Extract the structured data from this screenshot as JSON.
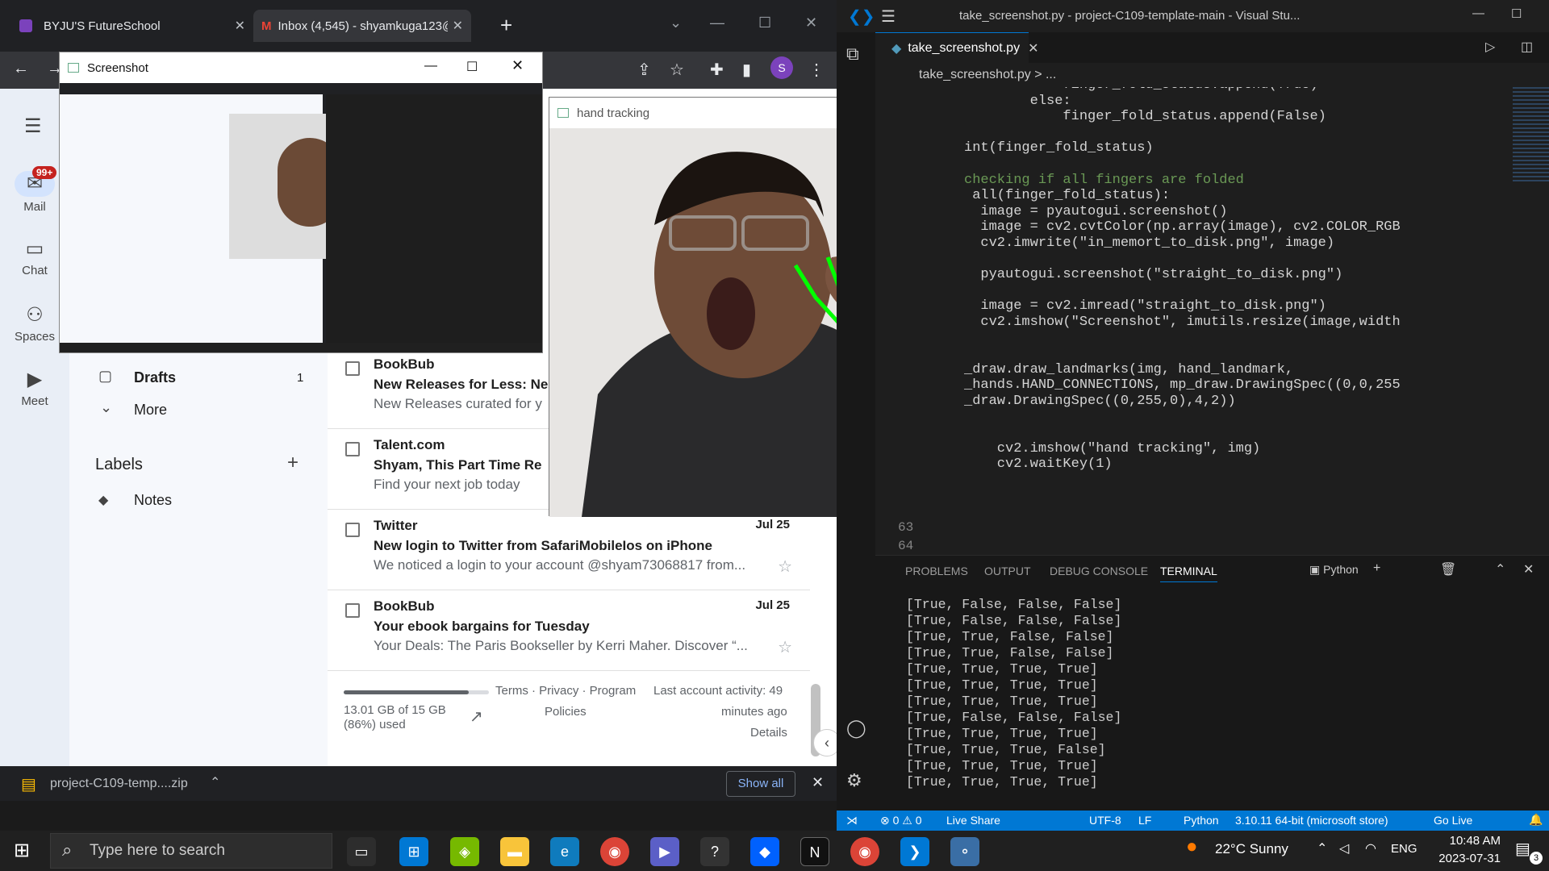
{
  "chrome": {
    "tab1_title": "BYJU'S FutureSchool",
    "tab2_title": "Inbox (4,545) - shyamkuga123@",
    "avatar_letter": "S"
  },
  "gmail": {
    "rail": {
      "mail": "Mail",
      "chat": "Chat",
      "spaces": "Spaces",
      "meet": "Meet",
      "badge": "99+"
    },
    "nav": {
      "drafts": "Drafts",
      "drafts_count": "1",
      "more": "More",
      "labels": "Labels",
      "notes": "Notes"
    },
    "emails": [
      {
        "sender": "BookBub",
        "subject": "New Releases for Less: Ne",
        "snippet": "New Releases curated for y",
        "date": ""
      },
      {
        "sender": "Talent.com",
        "subject": "Shyam, This Part Time Re",
        "snippet": "Find your next job today",
        "date": ""
      },
      {
        "sender": "Twitter",
        "subject": "New login to Twitter from SafariMobileIos on iPhone",
        "snippet": "We noticed a login to your account @shyam73068817 from...",
        "date": "Jul 25"
      },
      {
        "sender": "BookBub",
        "subject": "Your ebook bargains for Tuesday",
        "snippet": "Your Deals: The Paris Bookseller by Kerri Maher. Discover “...",
        "date": "Jul 25"
      }
    ],
    "storage": {
      "used": "13.01 GB of 15 GB",
      "pct": "(86%) used",
      "fraction": 0.86
    },
    "footer": {
      "terms": "Terms · Privacy · Program",
      "policies": "Policies",
      "activity1": "Last account activity: 49",
      "activity2": "minutes ago",
      "details": "Details"
    }
  },
  "download": {
    "file": "project-C109-temp....zip",
    "show_all": "Show all"
  },
  "screenshot_window": {
    "title": "Screenshot"
  },
  "hand_window": {
    "title": "hand tracking"
  },
  "vscode": {
    "title": "take_screenshot.py - project-C109-template-main - Visual Stu...",
    "tab": "take_screenshot.py",
    "breadcrumb": "take_screenshot.py > ...",
    "code_lines": [
      "            finger_fold_status.append(True)",
      "        else:",
      "            finger_fold_status.append(False)",
      "",
      "int(finger_fold_status)",
      "",
      "checking if all fingers are folded",
      " all(finger_fold_status):",
      "  image = pyautogui.screenshot()",
      "  image = cv2.cvtColor(np.array(image), cv2.COLOR_RGB",
      "  cv2.imwrite(\"in_memort_to_disk.png\", image)",
      "",
      "  pyautogui.screenshot(\"straight_to_disk.png\")",
      "",
      "  image = cv2.imread(\"straight_to_disk.png\")",
      "  cv2.imshow(\"Screenshot\", imutils.resize(image,width",
      "",
      "",
      "_draw.draw_landmarks(img, hand_landmark,",
      "_hands.HAND_CONNECTIONS, mp_draw.DrawingSpec((0,0,255",
      "_draw.DrawingSpec((0,255,0),4,2))",
      "",
      "",
      "    cv2.imshow(\"hand tracking\", img)",
      "    cv2.waitKey(1)"
    ],
    "line_63": "63",
    "line_64": "64",
    "panel_tabs": [
      "PROBLEMS",
      "OUTPUT",
      "DEBUG CONSOLE",
      "TERMINAL"
    ],
    "terminal_profile": "Python",
    "terminal_lines": [
      "[True, False, False, False]",
      "[True, False, False, False]",
      "[True, True, False, False]",
      "[True, True, False, False]",
      "[True, True, True, True]",
      "[True, True, True, True]",
      "[True, True, True, True]",
      "[True, False, False, False]",
      "[True, True, True, True]",
      "[True, True, True, False]",
      "[True, True, True, True]",
      "[True, True, True, True]"
    ],
    "status": {
      "errors": "0",
      "warnings": "0",
      "live_share": "Live Share",
      "encoding": "UTF-8",
      "eol": "LF",
      "lang": "Python",
      "interpreter": "3.10.11 64-bit (microsoft store)",
      "go_live": "Go Live"
    }
  },
  "taskbar": {
    "search_placeholder": "Type here to search",
    "weather": "22°C  Sunny",
    "lang": "ENG",
    "time": "10:48 AM",
    "date": "2023-07-31",
    "notif_count": "3"
  },
  "colors": {
    "vscode_blue": "#0078d4",
    "hand_green": "#00ff00",
    "landmark_red": "#ff0000",
    "gmail_badge": "#c5221f"
  }
}
